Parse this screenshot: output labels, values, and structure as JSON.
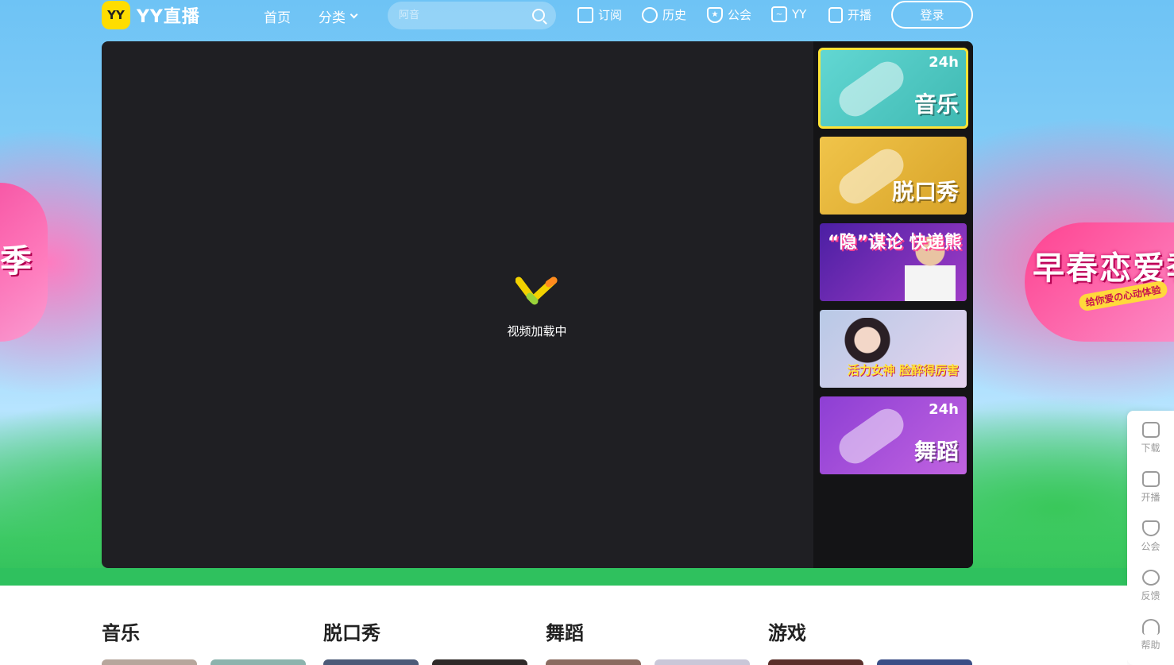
{
  "header": {
    "logo_mark": "YY",
    "logo_text": "YY直播",
    "nav": {
      "home": "首页",
      "category": "分类"
    },
    "search": {
      "placeholder": "阿音"
    },
    "tools": {
      "subscribe": "订阅",
      "history": "历史",
      "guild": "公会",
      "yy": "YY",
      "live": "开播"
    },
    "login": "登录"
  },
  "hero": {
    "left_banner_text": "季",
    "right_banner_text": "早春恋爱季",
    "right_banner_sub": "给你爱の心动体验"
  },
  "player": {
    "loading_text": "视频加载中",
    "cards": [
      {
        "badge": "24h",
        "label": "音乐",
        "active": true
      },
      {
        "label": "脱口秀"
      },
      {
        "label": "“隐”谋论 快递熊"
      },
      {
        "label": "活力女神 脸醉得厉害"
      },
      {
        "badge": "24h",
        "label": "舞蹈"
      }
    ]
  },
  "float_bar": {
    "download": "下载",
    "live": "开播",
    "guild": "公会",
    "feedback": "反馈",
    "help": "帮助"
  },
  "categories": [
    {
      "title": "音乐"
    },
    {
      "title": "脱口秀"
    },
    {
      "title": "舞蹈"
    },
    {
      "title": "游戏"
    }
  ],
  "colors": {
    "accent_yellow": "#ffdd00",
    "player_bg": "#1f1f23",
    "active_card_outline": "#ffe436"
  }
}
